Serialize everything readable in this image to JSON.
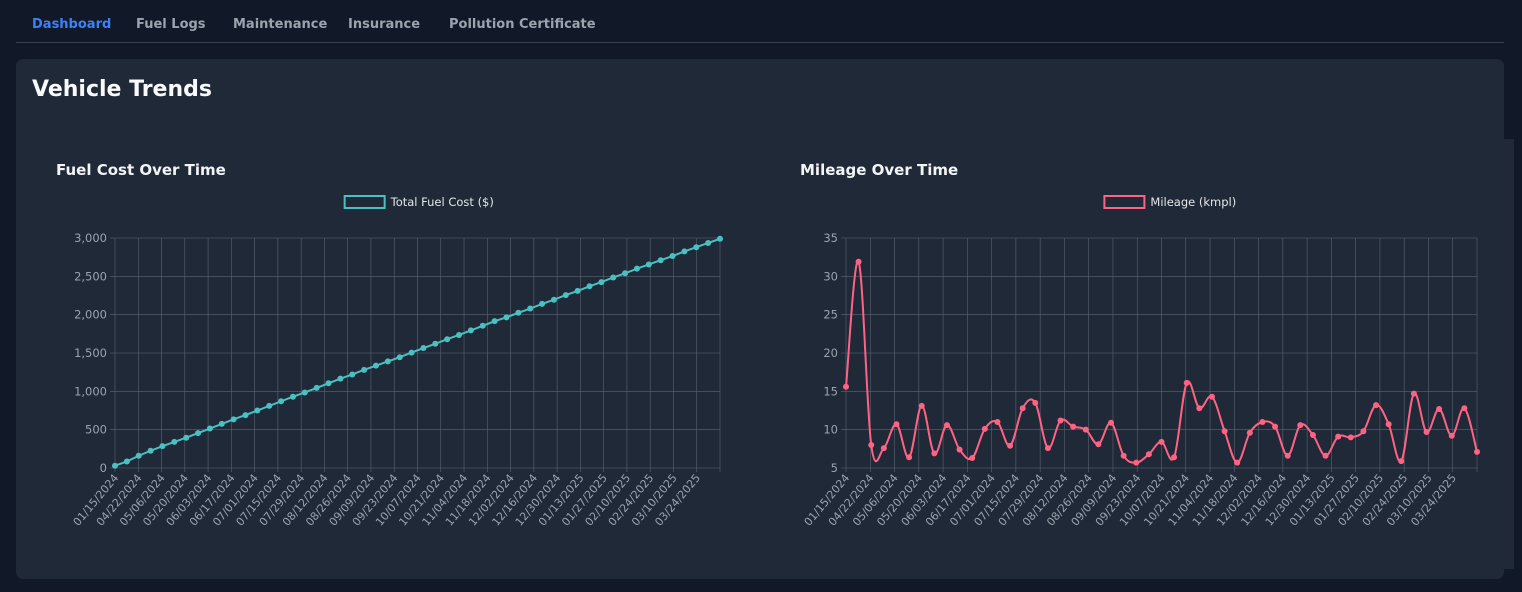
{
  "nav": {
    "tabs": [
      {
        "label": "Dashboard",
        "active": true
      },
      {
        "label": "Fuel Logs",
        "active": false
      },
      {
        "label": "Maintenance",
        "active": false
      },
      {
        "label": "Insurance",
        "active": false
      },
      {
        "label": "Pollution Certificate",
        "active": false
      }
    ]
  },
  "main": {
    "title": "Vehicle Trends"
  },
  "colors": {
    "accent": "#3b82f6",
    "fuel_series": "#4bc0c0",
    "mileage_series": "#ff6384",
    "grid": "#5b6473",
    "tick": "#9ca3af"
  },
  "chart_data": [
    {
      "type": "line",
      "title": "Fuel Cost Over Time",
      "legend_position": "top",
      "grid": true,
      "ylim": [
        0,
        3000
      ],
      "yticks": [
        0,
        500,
        1000,
        1500,
        2000,
        2500,
        3000
      ],
      "ytick_labels": [
        "0",
        "500",
        "1,000",
        "1,500",
        "2,000",
        "2,500",
        "3,000"
      ],
      "xtick_labels": [
        "01/15/2024",
        "04/22/2024",
        "05/06/2024",
        "05/20/2024",
        "06/03/2024",
        "06/17/2024",
        "07/01/2024",
        "07/15/2024",
        "07/29/2024",
        "08/12/2024",
        "08/26/2024",
        "09/09/2024",
        "09/23/2024",
        "10/07/2024",
        "10/21/2024",
        "11/04/2024",
        "11/18/2024",
        "12/02/2024",
        "12/16/2024",
        "12/30/2024",
        "01/13/2025",
        "01/27/2025",
        "02/10/2025",
        "02/24/2025",
        "03/10/2025",
        "03/24/2025"
      ],
      "series": [
        {
          "name": "Total Fuel Cost ($)",
          "color": "#4bc0c0",
          "values": [
            30,
            85,
            160,
            225,
            285,
            340,
            395,
            455,
            515,
            575,
            635,
            690,
            750,
            810,
            870,
            930,
            985,
            1045,
            1105,
            1165,
            1220,
            1280,
            1335,
            1390,
            1445,
            1505,
            1565,
            1620,
            1680,
            1735,
            1795,
            1855,
            1915,
            1965,
            2025,
            2080,
            2140,
            2195,
            2255,
            2310,
            2370,
            2425,
            2485,
            2540,
            2600,
            2655,
            2710,
            2765,
            2825,
            2880,
            2935,
            2990
          ]
        }
      ]
    },
    {
      "type": "line",
      "title": "Mileage Over Time",
      "legend_position": "top",
      "grid": true,
      "ylim": [
        5,
        35
      ],
      "yticks": [
        5,
        10,
        15,
        20,
        25,
        30,
        35
      ],
      "ytick_labels": [
        "5",
        "10",
        "15",
        "20",
        "25",
        "30",
        "35"
      ],
      "xtick_labels": [
        "01/15/2024",
        "04/22/2024",
        "05/06/2024",
        "05/20/2024",
        "06/03/2024",
        "06/17/2024",
        "07/01/2024",
        "07/15/2024",
        "07/29/2024",
        "08/12/2024",
        "08/26/2024",
        "09/09/2024",
        "09/23/2024",
        "10/07/2024",
        "10/21/2024",
        "11/04/2024",
        "11/18/2024",
        "12/02/2024",
        "12/16/2024",
        "12/30/2024",
        "01/13/2025",
        "01/27/2025",
        "02/10/2025",
        "02/24/2025",
        "03/10/2025",
        "03/24/2025"
      ],
      "series": [
        {
          "name": "Mileage (kmpl)",
          "color": "#ff6384",
          "values": [
            15.6,
            31.9,
            8.0,
            7.6,
            10.7,
            6.4,
            13.1,
            6.9,
            10.6,
            7.4,
            6.3,
            10.1,
            11.0,
            7.9,
            12.8,
            13.5,
            7.6,
            11.2,
            10.4,
            10.0,
            8.1,
            10.9,
            6.6,
            5.7,
            6.8,
            8.4,
            6.4,
            16.1,
            12.8,
            14.3,
            9.8,
            5.7,
            9.6,
            11.0,
            10.4,
            6.6,
            10.6,
            9.3,
            6.6,
            9.1,
            9.0,
            9.8,
            13.2,
            10.7,
            5.9,
            14.7,
            9.7,
            12.7,
            9.2,
            12.8,
            7.1
          ]
        }
      ]
    }
  ]
}
